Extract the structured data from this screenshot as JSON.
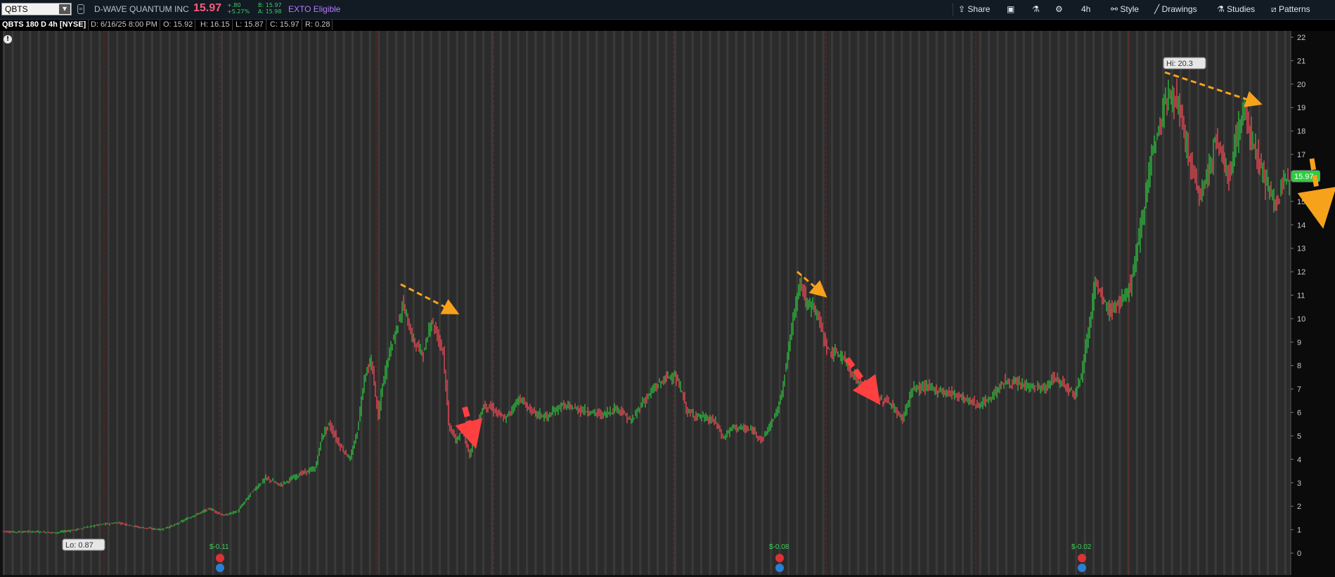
{
  "toolbar": {
    "symbol": "QBTS",
    "company": "D-WAVE QUANTUM INC",
    "last": "15.97",
    "change_abs": "+.80",
    "change_pct": "+5.27%",
    "bid": "B: 15.97",
    "ask": "A: 15.98",
    "exto": "EXTO Eligible",
    "share": "Share",
    "timeframe": "4h",
    "style": "Style",
    "drawings": "Drawings",
    "studies": "Studies",
    "patterns": "Patterns"
  },
  "infobar": {
    "title": "QBTS 180 D 4h [NYSE]",
    "date": "D: 6/16/25 8:00 PM",
    "open": "O: 15.92",
    "high": "H: 16.15",
    "low": "L: 15.87",
    "close": "C: 15.97",
    "range": "R: 0.28"
  },
  "chart_data": {
    "type": "line",
    "title": "QBTS 180 D 4h [NYSE]",
    "x_unit": "4-hour bars (180 days)",
    "ylim": [
      -0.8,
      22.2
    ],
    "y_ticks": [
      0,
      1,
      2,
      3,
      4,
      5,
      6,
      7,
      8,
      9,
      10,
      11,
      12,
      13,
      14,
      15,
      16,
      17,
      18,
      19,
      20,
      21,
      22
    ],
    "price_path": [
      [
        0,
        0.95
      ],
      [
        20,
        0.9
      ],
      [
        50,
        0.92
      ],
      [
        80,
        0.87
      ],
      [
        110,
        1.0
      ],
      [
        140,
        1.2
      ],
      [
        170,
        1.3
      ],
      [
        200,
        1.1
      ],
      [
        230,
        1.0
      ],
      [
        250,
        1.2
      ],
      [
        270,
        1.5
      ],
      [
        300,
        1.9
      ],
      [
        320,
        1.6
      ],
      [
        340,
        1.8
      ],
      [
        360,
        2.6
      ],
      [
        380,
        3.2
      ],
      [
        400,
        2.9
      ],
      [
        430,
        3.4
      ],
      [
        450,
        3.6
      ],
      [
        460,
        5.0
      ],
      [
        470,
        5.5
      ],
      [
        485,
        4.6
      ],
      [
        500,
        4.0
      ],
      [
        510,
        5.2
      ],
      [
        520,
        7.5
      ],
      [
        530,
        8.2
      ],
      [
        540,
        5.8
      ],
      [
        545,
        7.0
      ],
      [
        555,
        8.5
      ],
      [
        565,
        9.5
      ],
      [
        575,
        10.6
      ],
      [
        590,
        9.0
      ],
      [
        605,
        8.5
      ],
      [
        615,
        10.0
      ],
      [
        620,
        9.6
      ],
      [
        632,
        8.7
      ],
      [
        640,
        5.5
      ],
      [
        650,
        4.8
      ],
      [
        660,
        5.2
      ],
      [
        670,
        4.2
      ],
      [
        680,
        5.5
      ],
      [
        690,
        6.3
      ],
      [
        700,
        6.2
      ],
      [
        720,
        5.7
      ],
      [
        740,
        6.6
      ],
      [
        760,
        6.0
      ],
      [
        780,
        5.8
      ],
      [
        800,
        6.3
      ],
      [
        830,
        6.1
      ],
      [
        860,
        5.9
      ],
      [
        880,
        6.2
      ],
      [
        900,
        5.6
      ],
      [
        915,
        6.4
      ],
      [
        935,
        7.1
      ],
      [
        950,
        7.5
      ],
      [
        960,
        7.6
      ],
      [
        970,
        7.0
      ],
      [
        980,
        6.0
      ],
      [
        1000,
        5.8
      ],
      [
        1020,
        5.6
      ],
      [
        1030,
        4.9
      ],
      [
        1045,
        5.4
      ],
      [
        1060,
        5.3
      ],
      [
        1075,
        5.2
      ],
      [
        1085,
        4.8
      ],
      [
        1100,
        5.6
      ],
      [
        1110,
        6.3
      ],
      [
        1120,
        8.0
      ],
      [
        1130,
        10.0
      ],
      [
        1140,
        11.7
      ],
      [
        1150,
        10.5
      ],
      [
        1160,
        10.6
      ],
      [
        1170,
        9.6
      ],
      [
        1180,
        8.6
      ],
      [
        1200,
        8.4
      ],
      [
        1215,
        7.6
      ],
      [
        1230,
        7.1
      ],
      [
        1250,
        6.5
      ],
      [
        1265,
        6.5
      ],
      [
        1285,
        5.7
      ],
      [
        1300,
        7.0
      ],
      [
        1320,
        7.1
      ],
      [
        1340,
        6.9
      ],
      [
        1360,
        6.8
      ],
      [
        1380,
        6.5
      ],
      [
        1395,
        6.3
      ],
      [
        1410,
        6.6
      ],
      [
        1430,
        7.3
      ],
      [
        1450,
        7.2
      ],
      [
        1470,
        7.1
      ],
      [
        1490,
        7.0
      ],
      [
        1500,
        7.5
      ],
      [
        1520,
        7.1
      ],
      [
        1530,
        6.8
      ],
      [
        1540,
        7.6
      ],
      [
        1550,
        9.5
      ],
      [
        1560,
        11.5
      ],
      [
        1570,
        10.8
      ],
      [
        1580,
        10.3
      ],
      [
        1590,
        10.6
      ],
      [
        1600,
        10.8
      ],
      [
        1610,
        11.5
      ],
      [
        1620,
        13.0
      ],
      [
        1630,
        15.0
      ],
      [
        1640,
        17.0
      ],
      [
        1650,
        18.0
      ],
      [
        1660,
        19.3
      ],
      [
        1670,
        19.6
      ],
      [
        1678,
        19.0
      ],
      [
        1690,
        17.3
      ],
      [
        1700,
        16.0
      ],
      [
        1710,
        15.2
      ],
      [
        1720,
        16.2
      ],
      [
        1730,
        17.5
      ],
      [
        1740,
        17.0
      ],
      [
        1750,
        16.0
      ],
      [
        1760,
        17.7
      ],
      [
        1770,
        18.8
      ],
      [
        1778,
        18.2
      ],
      [
        1790,
        17.0
      ],
      [
        1800,
        16.0
      ],
      [
        1810,
        15.2
      ],
      [
        1820,
        15.0
      ],
      [
        1830,
        15.9
      ],
      [
        1835,
        15.97
      ]
    ],
    "hi_label": "Hi: 20.3",
    "lo_label": "Lo: 0.87",
    "last_label": "15.97",
    "earnings": [
      {
        "label": "$-0.11"
      },
      {
        "label": "$-0.08"
      },
      {
        "label": "$-0.02"
      }
    ],
    "grid": true,
    "colors": {
      "up": "#2ecc40",
      "down": "#ff4d5a",
      "background": "#2b2b2b",
      "stripe": "#3a3a3a",
      "annotation_orange": "#f7a21b",
      "annotation_red": "#ff4040",
      "axis_text": "#c8c8c8",
      "session_line": "#8c1a1a"
    }
  }
}
